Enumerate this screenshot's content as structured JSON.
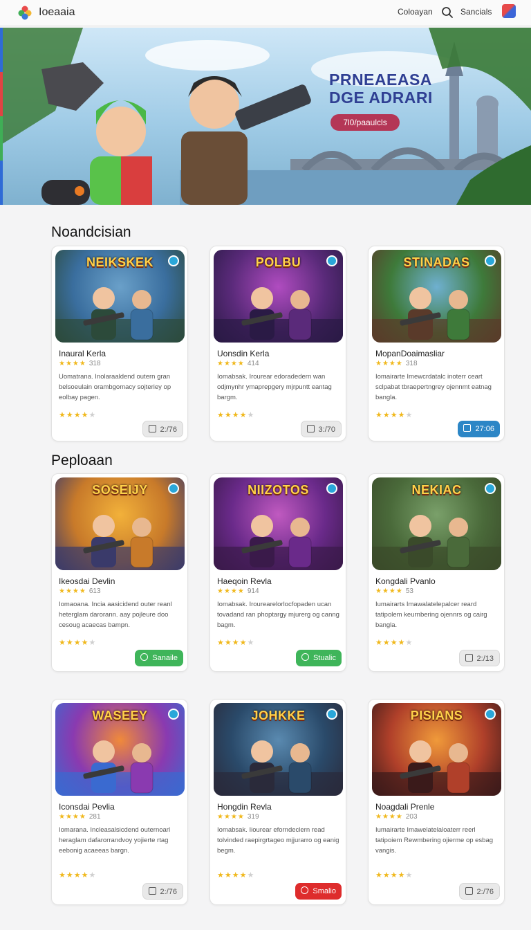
{
  "header": {
    "brand": "Ioeaaia",
    "nav_link": "Coloayan",
    "nav_link2": "Sancials",
    "search_icon": "search-icon"
  },
  "hero": {
    "title_line1": "PRNEAEASA",
    "title_line2": "DGE ADRARI",
    "button": "7l0/paaulcls"
  },
  "sections": [
    {
      "title": "Noandcisian",
      "cards": [
        {
          "thumb_title": "NEIKSKEK",
          "name": "Inaural Kerla",
          "stars": "★★★★",
          "score": "318",
          "desc": "Uomatrana. Inolaraaldend outern gran belsoeulain orambgomacy sojteriey op eolbay pagen.",
          "rating": 4,
          "action": "2:/76",
          "action_style": "gray"
        },
        {
          "thumb_title": "POLBU",
          "name": "Uonsdin Kerla",
          "stars": "★★★★",
          "score": "414",
          "desc": "Iomabsak. Irourear edoradedern wan odjmynhr ymaprepgery mjrpuntt eantag bargm.",
          "rating": 4,
          "action": "3:/70",
          "action_style": "gray"
        },
        {
          "thumb_title": "STINADAS",
          "name": "MopanDoaimasliar",
          "stars": "★★★★",
          "score": "318",
          "desc": "Iomairarte Imewcrdatalc inoterr ceart sclpabat tbraepertngrey ojennmt eatnag bangla.",
          "rating": 4,
          "action": "27:06",
          "action_style": "blue"
        }
      ]
    },
    {
      "title": "Peploaan",
      "cards": [
        {
          "thumb_title": "SOSEIJY",
          "name": "Ikeosdai Devlin",
          "stars": "★★★★",
          "score": "613",
          "desc": "Iomaoana. Incia aasicidend outer reanl heterglam darorann. aay pojleure doo cesoug acaecas bampn.",
          "rating": 4,
          "action": "Sanaile",
          "action_style": "green"
        },
        {
          "thumb_title": "NIIZOTOS",
          "name": "Haeqoin Revla",
          "stars": "★★★★",
          "score": "914",
          "desc": "Iomabsak. Irourearelorlocfopaden ucan tovadand ran phoptargy mjurerg og canng bagm.",
          "rating": 4,
          "action": "Stualic",
          "action_style": "green"
        },
        {
          "thumb_title": "NEKIAC",
          "name": "Kongdali Pvanlo",
          "stars": "★★★★",
          "score": "53",
          "desc": "Iumairarts Imawalatelepalcer reard tatipolem keurnbering ojennrs og cairg bangla.",
          "rating": 4,
          "action": "2:/13",
          "action_style": "gray"
        }
      ]
    },
    {
      "title": "",
      "cards": [
        {
          "thumb_title": "WASEEY",
          "name": "Iconsdai Pevlia",
          "stars": "★★★★",
          "score": "281",
          "desc": "Iomarana. Incleasalsicdend outernoarl heraglam dafarorrandvoy yojierte rtag eebonig acaeeas bargn.",
          "rating": 4,
          "action": "2:/76",
          "action_style": "gray"
        },
        {
          "thumb_title": "JOHKKE",
          "name": "Hongdin Revla",
          "stars": "★★★★",
          "score": "319",
          "desc": "Iomabsak. Iiourear eforndeclern read tolvinded raepirgrtageo mjjurarro og eanig begm.",
          "rating": 4,
          "action": "Smalio",
          "action_style": "red"
        },
        {
          "thumb_title": "PISIANS",
          "name": "Noagdali Prenle",
          "stars": "★★★★",
          "score": "203",
          "desc": "Iumairarte Imawelatelaloaterr reerl tatipoiem Rewmbering ojierme op esbag vangis.",
          "rating": 4,
          "action": "2:/76",
          "action_style": "gray"
        }
      ]
    }
  ]
}
